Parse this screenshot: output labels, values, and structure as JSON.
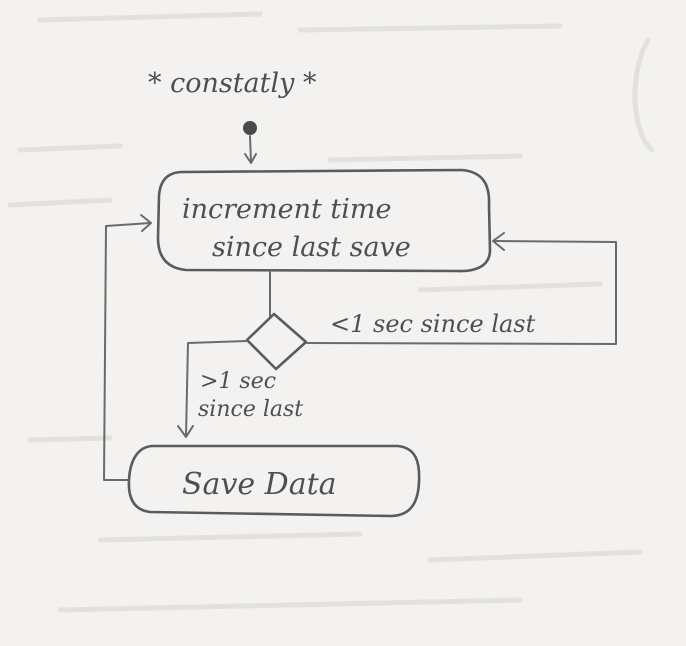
{
  "diagram": {
    "trigger_label": "* constatly *",
    "nodes": {
      "increment": {
        "line1": "increment time",
        "line2": "since last save"
      },
      "save": {
        "label": "Save Data"
      }
    },
    "edges": {
      "less_than": "<1 sec since last",
      "greater_than_line1": ">1 sec",
      "greater_than_line2": "since last"
    }
  }
}
